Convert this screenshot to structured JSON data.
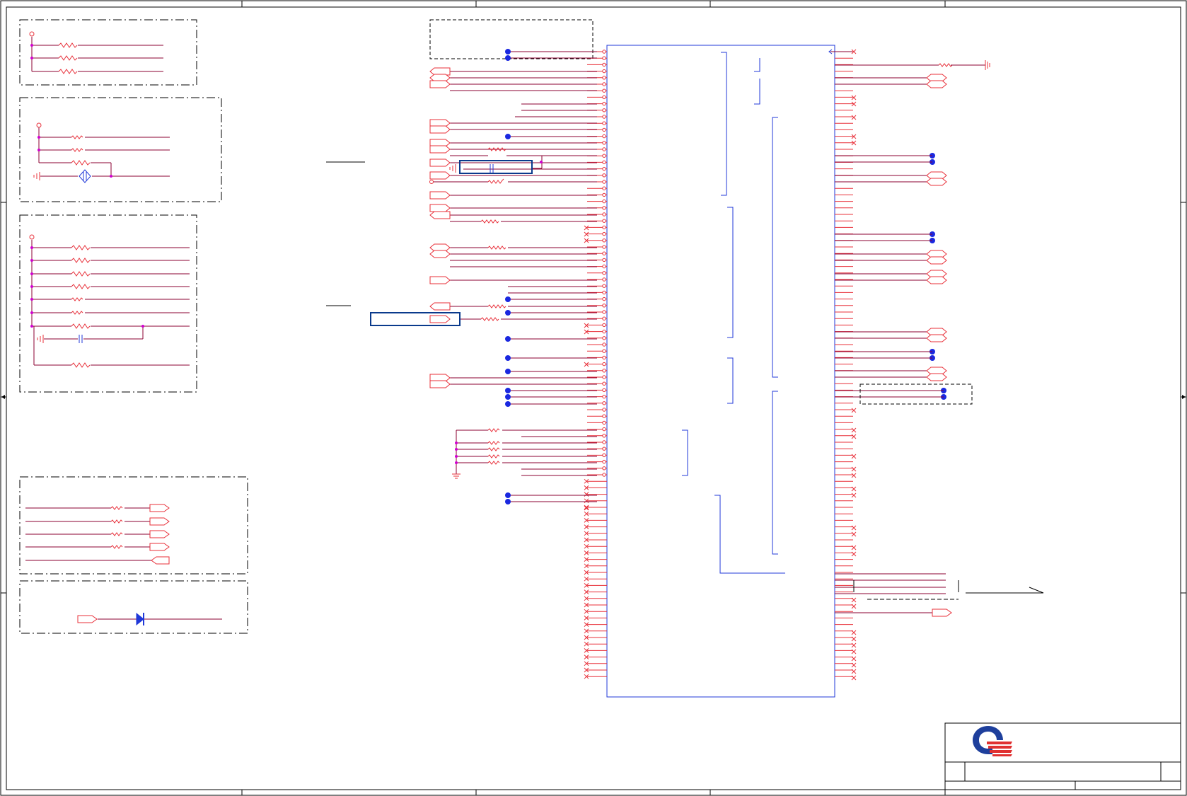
{
  "sheet": {
    "background": "#ffffff",
    "border_color": "#000000",
    "wire_color": "#8b0030",
    "pin_color": "#e8303a",
    "body_color": "#2038d8",
    "junction_color": "#d000d0",
    "net_dot_color": "#1a28e0",
    "highlight_color": "#0a3a8c"
  },
  "title_block": {
    "logo": "quanta-logo",
    "logo_colors": {
      "ring": "#1e3f9c",
      "stripes": "#e03030"
    }
  }
}
